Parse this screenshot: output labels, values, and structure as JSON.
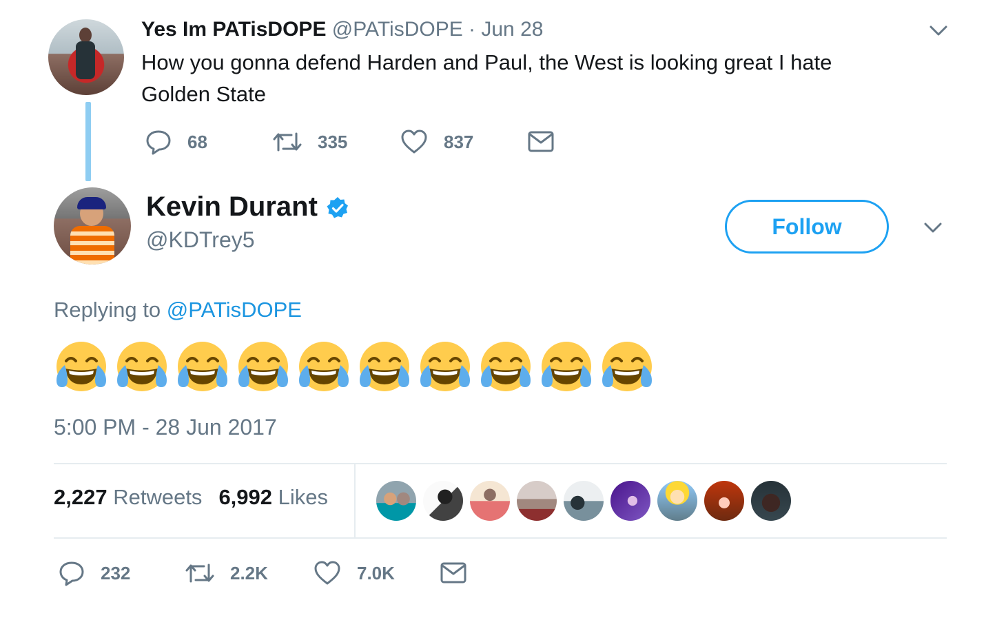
{
  "parent_tweet": {
    "name": "Yes Im PATisDOPE",
    "handle_date": "@PATisDOPE · Jun 28",
    "text_line1": "How you gonna defend Harden and Paul, the West is looking great I hate",
    "text_line2": "Golden State",
    "reply_count": "68",
    "retweet_count": "335",
    "like_count": "837"
  },
  "tweet": {
    "name": "Kevin Durant",
    "handle": "@KDTrey5",
    "follow_label": "Follow",
    "replying_prefix": "Replying to",
    "replying_handle": "@PATisDOPE",
    "emoji_name": "face-with-tears-of-joy",
    "emoji_count": 10,
    "timestamp": "5:00 PM - 28 Jun 2017",
    "retweets_value": "2,227",
    "retweets_label": "Retweets",
    "likes_value": "6,992",
    "likes_label": "Likes",
    "reply_count": "232",
    "retweet_count": "2.2K",
    "like_count": "7.0K"
  },
  "colors": {
    "accent": "#1da1f2",
    "muted": "#657786",
    "thread_line": "#8ecdf2"
  },
  "icons": [
    "chevron-down-icon",
    "reply-icon",
    "retweet-icon",
    "heart-icon",
    "mail-icon",
    "verified-badge-icon"
  ]
}
